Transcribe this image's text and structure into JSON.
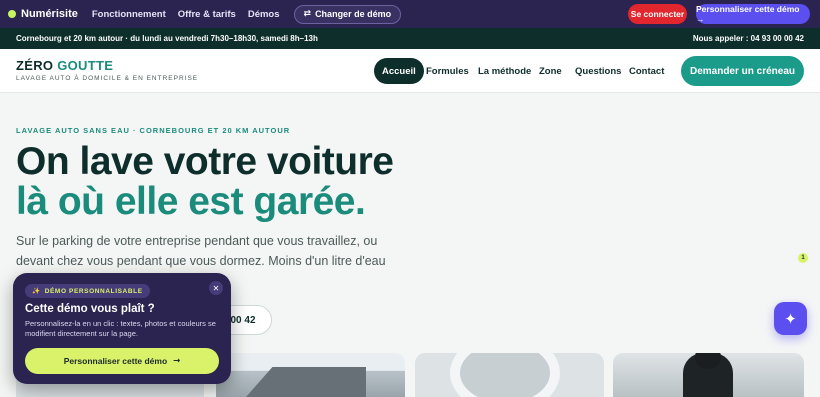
{
  "demo_bar": {
    "brand": "Numérisite",
    "links": [
      "Fonctionnement",
      "Offre & tarifs",
      "Démos"
    ],
    "switch_label": "Changer de démo",
    "switch_icon": "swap-arrows-icon",
    "login_label": "Se connecter",
    "personalize_label": "Personnaliser cette démo →",
    "colors": {
      "bar": "#2b2350",
      "login": "#e2262d",
      "personalize": "#5b4ff0"
    }
  },
  "info_bar": {
    "hours": "Cornebourg et 20 km autour · du lundi au vendredi 7h30–18h30, samedi 8h–13h",
    "phone": "Nous appeler : 04 93 00 00 42"
  },
  "nav": {
    "logo_part1": "ZÉRO",
    "logo_part2": "GOUTTE",
    "tagline": "LAVAGE AUTO À DOMICILE & EN ENTREPRISE",
    "items": [
      "Accueil",
      "Formules",
      "La méthode",
      "Zone",
      "Questions",
      "Contact"
    ],
    "active_item": "Accueil",
    "cta": "Demander un créneau",
    "colors": {
      "dark": "#0e2e2b",
      "teal": "#1b9b8a"
    }
  },
  "hero": {
    "eyebrow": "LAVAGE AUTO SANS EAU · CORNEBOURG ET 20 KM AUTOUR",
    "title_line1": "On lave votre voiture",
    "title_line2": "là où elle est garée.",
    "lead_line1": "Sur le parking de votre entreprise pendant que vous travaillez, ou",
    "lead_line2": "devant chez vous pendant que vous dormez. Moins d'un litre d'eau",
    "phone_fragment": "00 42",
    "marker": "1"
  },
  "popup": {
    "badge": "DÉMO PERSONNALISABLE",
    "badge_icon": "sparkle-icon",
    "close_icon": "close-icon",
    "title": "Cette démo vous plaît ?",
    "text": "Personnalisez-la en un clic : textes, photos et couleurs se modifient directement sur la page.",
    "button": "Personnaliser cette démo",
    "button_arrow": "→",
    "colors": {
      "bg": "#2b2350",
      "accent": "#d9f26a"
    }
  },
  "fab": {
    "icon": "sparkle-icon",
    "glyph": "✦"
  }
}
